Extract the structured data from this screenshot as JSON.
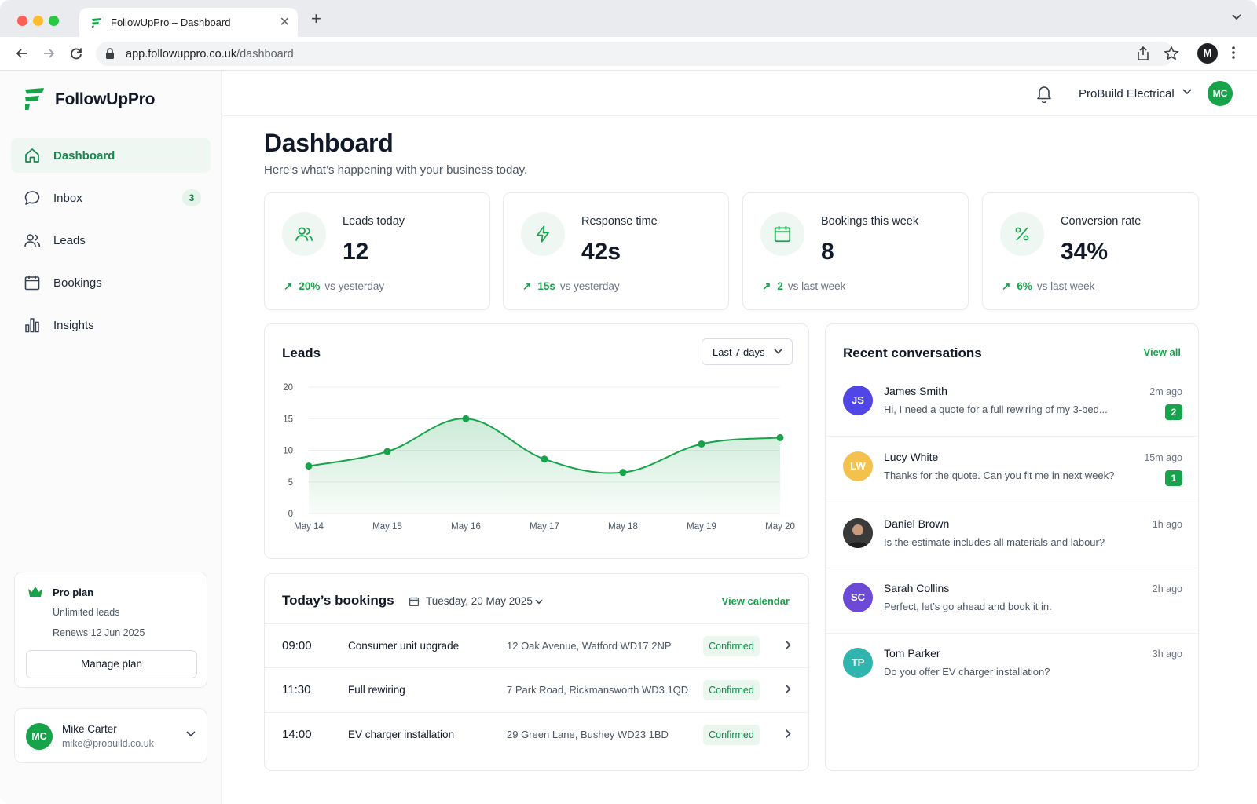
{
  "browser": {
    "tab_title": "FollowUpPro – Dashboard",
    "url_host": "app.followuppro.co.uk",
    "url_path": "/dashboard",
    "profile_initial": "M"
  },
  "brand": {
    "name": "FollowUpPro",
    "accent": "#16a34a"
  },
  "sidebar": {
    "items": [
      {
        "label": "Dashboard",
        "icon": "home-icon",
        "active": true
      },
      {
        "label": "Inbox",
        "icon": "chat-bubble-icon",
        "badge": "3"
      },
      {
        "label": "Leads",
        "icon": "users-icon"
      },
      {
        "label": "Bookings",
        "icon": "calendar-icon"
      },
      {
        "label": "Insights",
        "icon": "bar-chart-icon"
      }
    ],
    "plan": {
      "name": "Pro plan",
      "line1": "Unlimited leads",
      "line2": "Renews 12 Jun 2025",
      "button": "Manage plan"
    },
    "user": {
      "initials": "MC",
      "name": "Mike Carter",
      "email": "mike@probuild.co.uk"
    }
  },
  "header": {
    "org": "ProBuild Electrical",
    "avatar_initials": "MC"
  },
  "page": {
    "title": "Dashboard",
    "subtitle": "Here’s what’s happening with your business today."
  },
  "stats": [
    {
      "label": "Leads today",
      "value": "12",
      "arrow": "↗",
      "delta": "20%",
      "compare": "vs yesterday",
      "icon": "users-icon"
    },
    {
      "label": "Response time",
      "value": "42s",
      "arrow": "↗",
      "delta": "15s",
      "compare": "vs yesterday",
      "icon": "lightning-icon"
    },
    {
      "label": "Bookings this week",
      "value": "8",
      "arrow": "↗",
      "delta": "2",
      "compare": "vs last week",
      "icon": "calendar-icon"
    },
    {
      "label": "Conversion rate",
      "value": "34%",
      "arrow": "↗",
      "delta": "6%",
      "compare": "vs last week",
      "icon": "percent-icon"
    }
  ],
  "leads_chart": {
    "title": "Leads",
    "range": "Last 7 days"
  },
  "chart_data": {
    "type": "area",
    "title": "Leads",
    "categories": [
      "May 14",
      "May 15",
      "May 16",
      "May 17",
      "May 18",
      "May 19",
      "May 20"
    ],
    "values": [
      7.5,
      9.8,
      15,
      8.6,
      6.5,
      11,
      12
    ],
    "ylim": [
      0,
      20
    ],
    "yticks": [
      "0",
      "5",
      "10",
      "15",
      "20"
    ],
    "grid": true,
    "color": "#16a34a"
  },
  "conversations": {
    "title": "Recent conversations",
    "view_all": "View all",
    "items": [
      {
        "initials": "JS",
        "name": "James Smith",
        "message": "Hi, I need a quote for a full rewiring of my 3-bed...",
        "time": "2m ago",
        "unread": "2",
        "color": "#4f46e5"
      },
      {
        "initials": "LW",
        "name": "Lucy White",
        "message": "Thanks for the quote. Can you fit me in next week?",
        "time": "15m ago",
        "unread": "1",
        "color": "#f2c14e"
      },
      {
        "initials": "",
        "name": "Daniel Brown",
        "message": "Is the estimate includes all materials and labour?",
        "time": "1h ago",
        "unread": "",
        "color": "#2b2b2b"
      },
      {
        "initials": "SC",
        "name": "Sarah Collins",
        "message": "Perfect, let’s go ahead and book it in.",
        "time": "2h ago",
        "unread": "",
        "color": "#6d4ad6"
      },
      {
        "initials": "TP",
        "name": "Tom Parker",
        "message": "Do you offer EV charger installation?",
        "time": "3h ago",
        "unread": "",
        "color": "#2fb4ae"
      }
    ]
  },
  "bookings": {
    "title": "Today’s bookings",
    "date": "Tuesday, 20 May 2025",
    "view_calendar": "View calendar",
    "rows": [
      {
        "time": "09:00",
        "job": "Consumer unit upgrade",
        "address": "12 Oak Avenue, Watford WD17 2NP",
        "status": "Confirmed"
      },
      {
        "time": "11:30",
        "job": "Full rewiring",
        "address": "7 Park Road, Rickmansworth WD3 1QD",
        "status": "Confirmed"
      },
      {
        "time": "14:00",
        "job": "EV charger installation",
        "address": "29 Green Lane, Bushey WD23 1BD",
        "status": "Confirmed"
      }
    ]
  }
}
